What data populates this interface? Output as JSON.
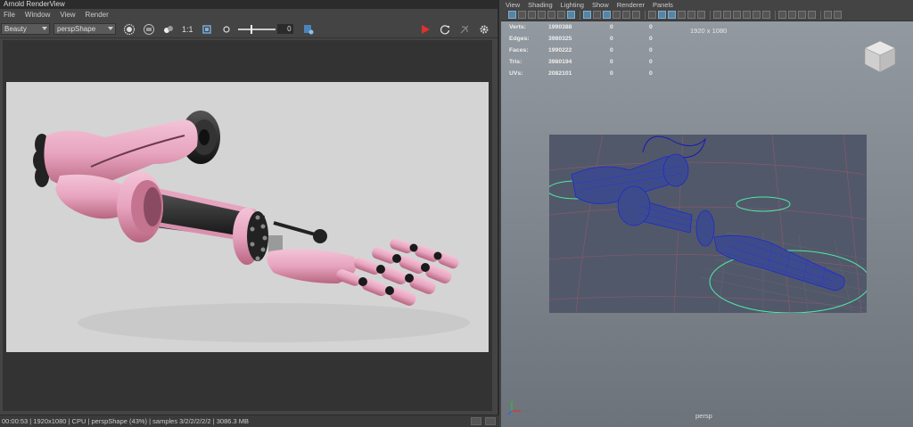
{
  "render_view": {
    "title": "Arnold RenderView",
    "menu": [
      "File",
      "Window",
      "View",
      "Render"
    ],
    "aov_select": "Beauty",
    "camera_select": "perspShape",
    "zoom_label": "1:1",
    "exposure_value": "0",
    "status": "00:00:53 | 1920x1080 | CPU | perspShape (43%) | samples 3/2/2/2/2/2 | 3086.3 MB"
  },
  "viewport": {
    "menu": [
      "View",
      "Shading",
      "Lighting",
      "Show",
      "Renderer",
      "Panels"
    ],
    "resolution_label": "1920 x 1080",
    "camera_label": "persp",
    "hud": [
      {
        "label": "Verts:",
        "value": "1990388",
        "a": "0",
        "b": "0"
      },
      {
        "label": "Edges:",
        "value": "3980325",
        "a": "0",
        "b": "0"
      },
      {
        "label": "Faces:",
        "value": "1990222",
        "a": "0",
        "b": "0"
      },
      {
        "label": "Tris:",
        "value": "3980194",
        "a": "0",
        "b": "0"
      },
      {
        "label": "UVs:",
        "value": "2082101",
        "a": "0",
        "b": "0"
      }
    ]
  },
  "colors": {
    "render_background": "#d4d4d4",
    "arm_pink": "#e7a4bf",
    "wireframe": "#1c2ad0",
    "viewport_gradient_top": "#949ba2",
    "viewport_gradient_bottom": "#6d737b",
    "render_button": "#e03030",
    "selection_circle": "#4ee8a8"
  }
}
